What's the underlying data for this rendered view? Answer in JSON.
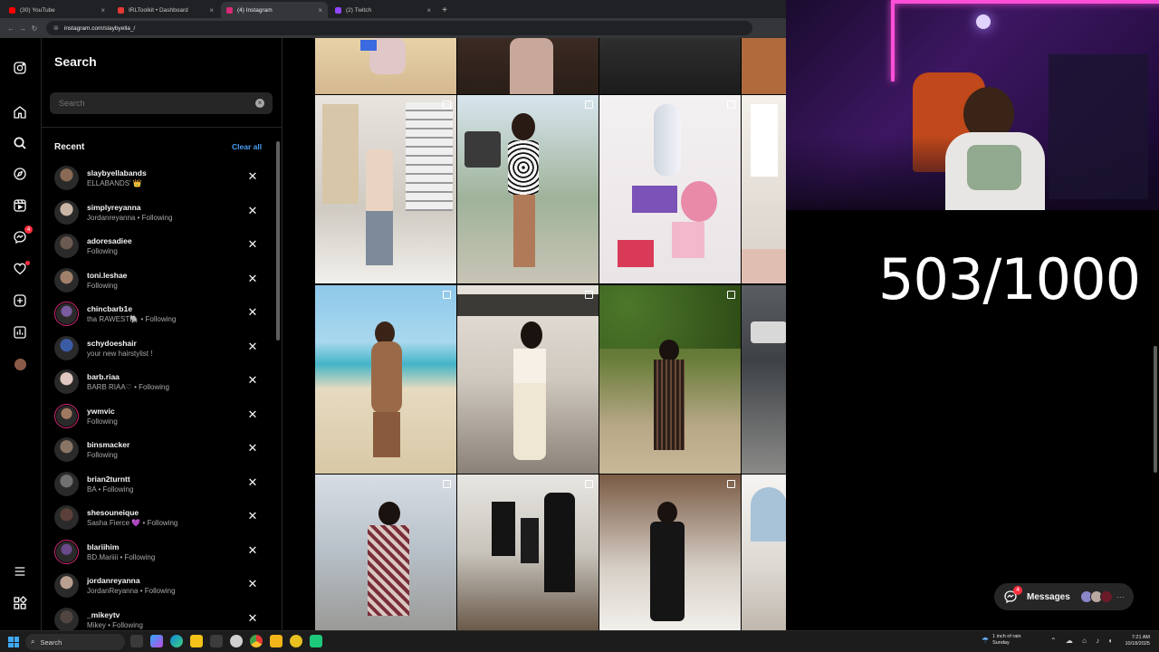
{
  "browser": {
    "tabs": [
      {
        "title": "(30) YouTube",
        "color": "#ff0000",
        "active": false
      },
      {
        "title": "IRLToolkit • Dashboard",
        "color": "#e53935",
        "active": false
      },
      {
        "title": "(4) Instagram",
        "color": "#d62976",
        "active": true
      },
      {
        "title": "(2) Twitch",
        "color": "#9146ff",
        "active": false
      }
    ],
    "new_tab": "+",
    "url": "instagram.com/slaybyella_/"
  },
  "search": {
    "title": "Search",
    "placeholder": "Search",
    "clear_icon": "×",
    "recent_label": "Recent",
    "clear_all_label": "Clear all"
  },
  "recent": [
    {
      "name": "slaybyellabands",
      "sub": "ELLABANDS' 👑",
      "avatar": "#8a6a55",
      "ring": false
    },
    {
      "name": "simplyreyanna",
      "sub": "Jordanreyanna • Following",
      "avatar": "#c9b5a5",
      "ring": false
    },
    {
      "name": "adoresadiee",
      "sub": "Following",
      "avatar": "#6b5a50",
      "ring": false
    },
    {
      "name": "toni.leshae",
      "sub": "Following",
      "avatar": "#a0806a",
      "ring": false
    },
    {
      "name": "chincbarb1e",
      "sub": "tha RAWEST🐘 • Following",
      "avatar": "#7a5ca0",
      "ring": true
    },
    {
      "name": "schydoeshair",
      "sub": "your new hairstylist !",
      "avatar": "#3b5ba5",
      "ring": false
    },
    {
      "name": "barb.riaa",
      "sub": "BARB RIAA♡ • Following",
      "avatar": "#e0c8c0",
      "ring": false
    },
    {
      "name": "ywmvic",
      "sub": "Following",
      "avatar": "#a07a60",
      "ring": true
    },
    {
      "name": "binsmacker",
      "sub": "Following",
      "avatar": "#8a7565",
      "ring": false
    },
    {
      "name": "brian2turntt",
      "sub": "BA • Following",
      "avatar": "#707070",
      "ring": false
    },
    {
      "name": "shesouneique",
      "sub": "Sasha Fierce 💜 • Following",
      "avatar": "#5a4038",
      "ring": false
    },
    {
      "name": "blariihim",
      "sub": "BD.Mariiii • Following",
      "avatar": "#6a4a8a",
      "ring": true
    },
    {
      "name": "jordanreyanna",
      "sub": "JordanReyanna • Following",
      "avatar": "#b8a090",
      "ring": false
    },
    {
      "name": "_mikeytv",
      "sub": "Mikey • Following",
      "avatar": "#504540",
      "ring": false
    }
  ],
  "nav_icons": [
    {
      "name": "instagram-logo-icon"
    },
    {
      "name": "home-icon"
    },
    {
      "name": "search-icon"
    },
    {
      "name": "explore-icon"
    },
    {
      "name": "reels-icon"
    },
    {
      "name": "messenger-icon",
      "badge": "4"
    },
    {
      "name": "notifications-heart-icon",
      "dot": true
    },
    {
      "name": "create-icon"
    },
    {
      "name": "dashboard-icon"
    },
    {
      "name": "profile-avatar-icon"
    },
    {
      "name": "more-menu-icon"
    },
    {
      "name": "threads-icon"
    }
  ],
  "overlay": {
    "counter": "503/1000"
  },
  "messages": {
    "label": "Messages",
    "badge": "4",
    "more": "···"
  },
  "taskbar": {
    "search": "Search",
    "weather": "1 inch of rain",
    "weather_day": "Sunday",
    "time": "7:21 AM",
    "date": "10/18/2025"
  },
  "colors": {
    "accent_link": "#4a9ff5",
    "notification": "#ff3040",
    "story_ring": "#d62976"
  }
}
